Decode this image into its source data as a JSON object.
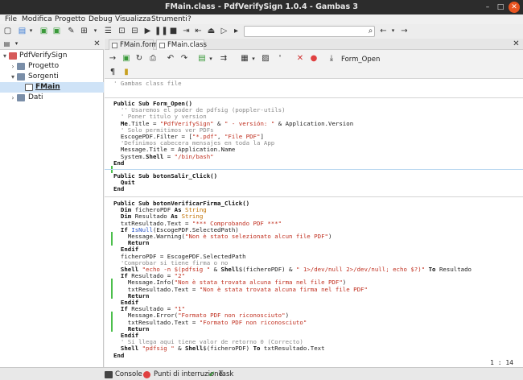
{
  "window": {
    "title": "FMain.class - PdfVerifySign 1.0.4 - Gambas 3"
  },
  "menu": [
    "File",
    "Modifica",
    "Progetto",
    "Debug",
    "Visualizza",
    "Strumenti",
    "?"
  ],
  "tree": {
    "root": "PdfVerifySign",
    "items": [
      {
        "label": "Progetto"
      },
      {
        "label": "Sorgenti"
      },
      {
        "label": "FMain"
      },
      {
        "label": "Dati"
      }
    ]
  },
  "tabs": [
    {
      "label": "FMain.form"
    },
    {
      "label": "FMain.class"
    }
  ],
  "editor_toolbar": {
    "form_open_label": "Form_Open"
  },
  "code": [
    "' Gambas class file",
    "",
    "Public Sub Form_Open()",
    "  '' Usaremos el poder de pdfsig (poppler-utils)",
    "  ' Poner titulo y version",
    "  Me.Title = \"PdfVerifySign\" & \" - versión: \" & Application.Version",
    "  ' Solo permitimos ver PDFs",
    "  EscogePDF.Filter = [\"*.pdf\", \"File PDF\"]",
    "  'Definimos cabecera mensajes en toda la App",
    "  Message.Title = Application.Name",
    "  System.Shell = \"/bin/bash\"",
    "End",
    "",
    "Public Sub botonSalir_Click()",
    "  Quit",
    "End",
    "",
    "Public Sub botonVerificarFirma_Click()",
    "  Dim ficheroPDF As String",
    "  Dim Resultado As String",
    "  txtResultado.Text = \"*** Comprobando PDF ***\"",
    "  If IsNull(EscogePDF.SelectedPath)",
    "    Message.Warning(\"Non è stato selezionato alcun file PDF\")",
    "    Return",
    "  Endif",
    "  ficheroPDF = EscogePDF.SelectedPath",
    "  'Comprobar si tiene firma o no",
    "  Shell \"echo -n $(pdfsig \" & Shell$(ficheroPDF) & \" 1>/dev/null 2>/dev/null; echo $?)\" To Resultado",
    "  If Resultado = \"2\"",
    "    Message.Info(\"Non è stata trovata alcuna firma nel file PDF\")",
    "    txtResultado.Text = \"Non è stata trovata alcuna firma nel file PDF\"",
    "    Return",
    "  Endif",
    "  If Resultado = \"1\"",
    "    Message.Error(\"Formato PDF non riconosciuto\")",
    "    txtResultado.Text = \"Formato PDF non riconosciuto\"",
    "    Return",
    "  Endif",
    "  ' Si llega aqui tiene valor de retorno 0 (Correcto)",
    "  Shell \"pdfsig \" & Shell$(ficheroPDF) To txtResultado.Text",
    "End"
  ],
  "cursor_position": "1 : 14",
  "status": {
    "console": "Console",
    "breakpoints": "Punti di interruzione",
    "task": "Task"
  },
  "colors": {
    "titlebar": "#2c2c2c",
    "selection": "#cfe3f7",
    "string": "#c03020",
    "function": "#2a55c8",
    "type": "#c07000"
  }
}
